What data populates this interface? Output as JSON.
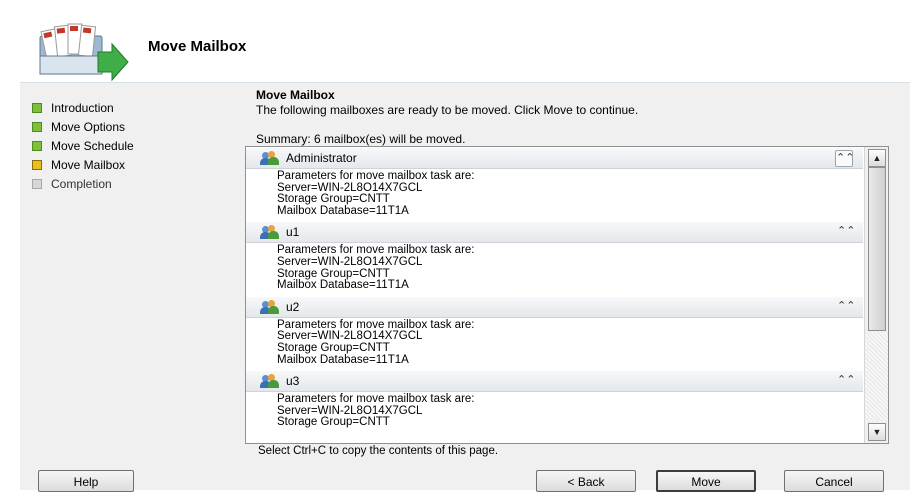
{
  "wizard": {
    "title": "Move Mailbox"
  },
  "nav": [
    {
      "label": "Introduction",
      "state": "done"
    },
    {
      "label": "Move Options",
      "state": "done"
    },
    {
      "label": "Move Schedule",
      "state": "done"
    },
    {
      "label": "Move Mailbox",
      "state": "current"
    },
    {
      "label": "Completion",
      "state": "todo"
    }
  ],
  "content": {
    "title": "Move Mailbox",
    "description": "The following mailboxes are ready to be moved. Click Move to continue.",
    "summary": "Summary: 6 mailbox(es) will be moved."
  },
  "mailboxes": [
    {
      "name": "Administrator",
      "line1": "Parameters for move mailbox task are:",
      "line2": "Server=WIN-2L8O14X7GCL",
      "line3": "Storage Group=CNTT",
      "line4": "Mailbox Database=11T1A"
    },
    {
      "name": "u1",
      "line1": "Parameters for move mailbox task are:",
      "line2": "Server=WIN-2L8O14X7GCL",
      "line3": "Storage Group=CNTT",
      "line4": "Mailbox Database=11T1A"
    },
    {
      "name": "u2",
      "line1": "Parameters for move mailbox task are:",
      "line2": "Server=WIN-2L8O14X7GCL",
      "line3": "Storage Group=CNTT",
      "line4": "Mailbox Database=11T1A"
    },
    {
      "name": "u3",
      "line1": "Parameters for move mailbox task are:",
      "line2": "Server=WIN-2L8O14X7GCL",
      "line3": "Storage Group=CNTT",
      "line4": ""
    }
  ],
  "copy_hint": "Select Ctrl+C to copy the contents of this page.",
  "buttons": {
    "help": "Help",
    "back": "< Back",
    "move": "Move",
    "cancel": "Cancel"
  },
  "colors": {
    "step_done": "#7ec03a",
    "step_current": "#e9c01b",
    "step_todo": "#d8d8d8"
  },
  "icons": {
    "wizard": "move-mailbox-wizard-icon",
    "mailbox": "mailbox-user-icon",
    "collapse": "double-chevron-up-icon"
  }
}
